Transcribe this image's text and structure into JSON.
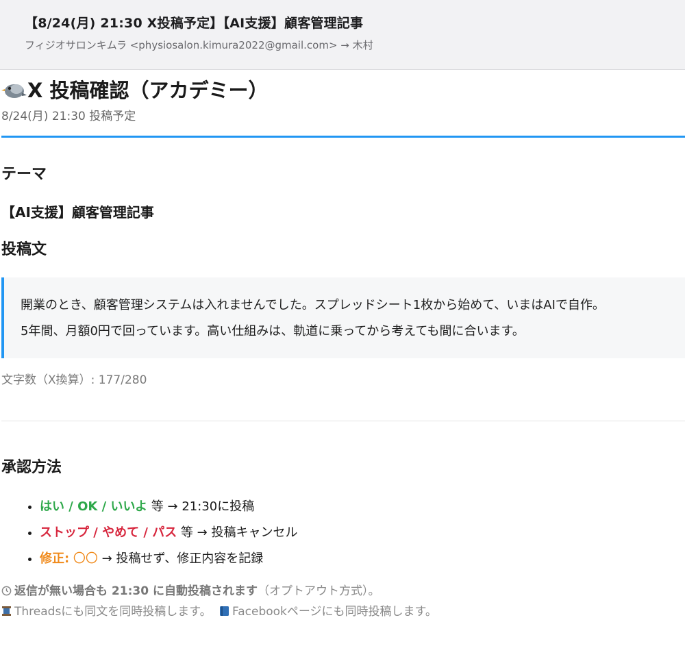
{
  "email": {
    "subject": "【8/24(月) 21:30 X投稿予定】【AI支援】顧客管理記事",
    "from_to": "フィジオサロンキムラ <physiosalon.kimura2022@gmail.com> → 木村"
  },
  "title": {
    "icon": "bird-icon",
    "text": "X 投稿確認（アカデミー）",
    "date": "8/24(月) 21:30 投稿予定"
  },
  "theme": {
    "heading": "テーマ",
    "value": "【AI支援】顧客管理記事"
  },
  "post": {
    "heading": "投稿文",
    "line1": "開業のとき、顧客管理システムは入れませんでした。スプレッドシート1枚から始めて、いまはAIで自作。",
    "line2": "5年間、月額0円で回っています。高い仕組みは、軌道に乗ってから考えても間に合います。",
    "char_count": "文字数（X換算）: 177/280"
  },
  "approval": {
    "heading": "承認方法",
    "items": [
      {
        "key": "はい / OK / いいよ",
        "rest": " 等 → 21:30に投稿",
        "color": "#2ea84a"
      },
      {
        "key": "ストップ / やめて / パス",
        "rest": " 等 → 投稿キャンセル",
        "color": "#d7263d"
      },
      {
        "key": "修正:",
        "placeholder": " 〇〇",
        "rest": " → 投稿せず、修正内容を記録",
        "color": "#f08a1b"
      }
    ]
  },
  "footer": {
    "auto_bold": "返信が無い場合も 21:30 に自動投稿されます",
    "auto_rest": "（オプトアウト方式）。",
    "threads": "Threadsにも同文を同時投稿します。",
    "facebook": "Facebookページにも同時投稿します。",
    "icons": [
      "clock-icon",
      "spool-icon",
      "book-icon"
    ]
  },
  "colors": {
    "accent": "#2196f3"
  }
}
